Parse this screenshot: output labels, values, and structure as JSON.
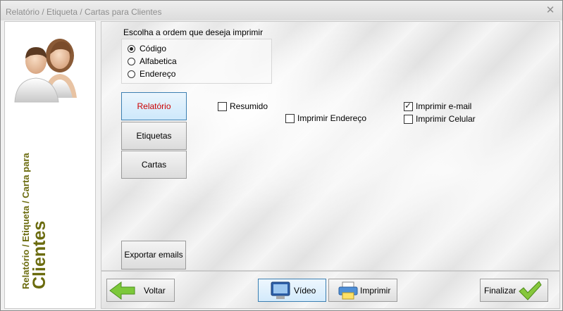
{
  "window": {
    "title": "Relatório / Etiqueta / Cartas para Clientes",
    "close_label": "✕"
  },
  "left_panel": {
    "title_small": "Relatório / Etiqueta / Carta para",
    "title_big": "Clientes"
  },
  "order": {
    "label": "Escolha a ordem que deseja imprimir",
    "options": [
      {
        "label": "Código",
        "selected": true
      },
      {
        "label": "Alfabetica",
        "selected": false
      },
      {
        "label": "Endereço",
        "selected": false
      }
    ]
  },
  "tabs": {
    "relatorio": "Relatório",
    "etiquetas": "Etiquetas",
    "cartas": "Cartas"
  },
  "options": {
    "resumido": {
      "label": "Resumido",
      "checked": false
    },
    "imprimir_endereco": {
      "label": "Imprimir Endereço",
      "checked": false
    },
    "imprimir_email": {
      "label": "Imprimir e-mail",
      "checked": true
    },
    "imprimir_celular": {
      "label": "Imprimir Celular",
      "checked": false
    }
  },
  "export_button": "Exportar emails",
  "footer": {
    "voltar": "Voltar",
    "video": "Vídeo",
    "imprimir": "Imprimir",
    "finalizar": "Finalizar"
  },
  "colors": {
    "accent_olive": "#6b6b0e",
    "active_tab_text": "#cc0000",
    "focus_border": "#3c7fb1"
  }
}
